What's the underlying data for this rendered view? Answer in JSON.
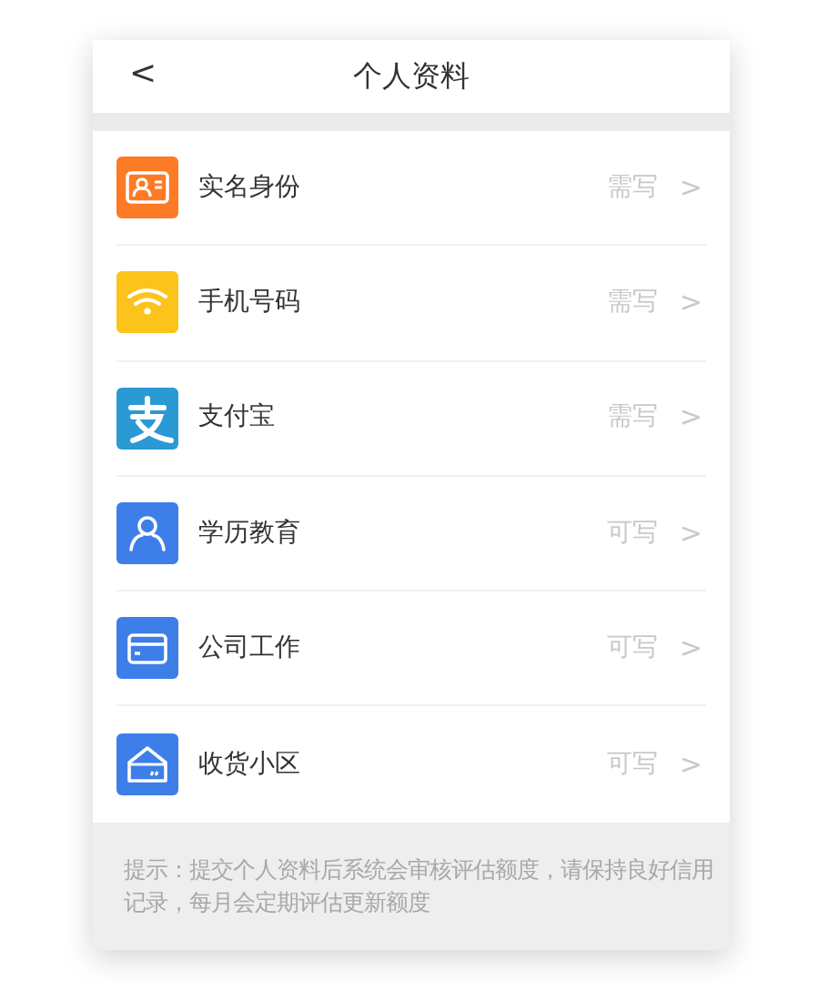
{
  "header": {
    "back": "<",
    "title": "个人资料"
  },
  "items": [
    {
      "label": "实名身份",
      "status": "需写",
      "kind": "idcard",
      "color": "#fd7a26"
    },
    {
      "label": "手机号码",
      "status": "需写",
      "kind": "signal",
      "color": "#fcc41b"
    },
    {
      "label": "支付宝",
      "status": "需写",
      "kind": "pay",
      "color": "#2a99d4"
    },
    {
      "label": "学历教育",
      "status": "可写",
      "kind": "person",
      "color": "#3d7ee8"
    },
    {
      "label": "公司工作",
      "status": "可写",
      "kind": "card",
      "color": "#3d7ee8"
    },
    {
      "label": "收货小区",
      "status": "可写",
      "kind": "house",
      "color": "#3d7ee8"
    }
  ],
  "chevron": ">",
  "tip": "提示：提交个人资料后系统会审核评估额度，请保持良好信用记录，每月会定期评估更新额度"
}
